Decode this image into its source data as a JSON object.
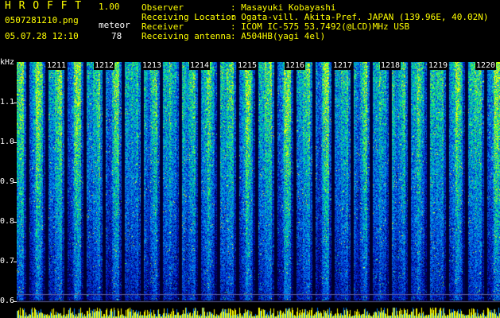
{
  "header": {
    "app_title": "H R O F F T",
    "version": "1.00",
    "filename": "0507281210.png",
    "datetime": "05.07.28 12:10",
    "meteor_label": "meteor",
    "meteor_count": "78"
  },
  "info": [
    {
      "label": "Observer",
      "value": ": Masayuki Kobayashi"
    },
    {
      "label": "Receiving Location",
      "value": ": Ogata-vill. Akita-Pref. JAPAN (139.96E, 40.02N)"
    },
    {
      "label": "Receiver",
      "value": ": ICOM IC-575 53.7492(@LCD)MHz USB"
    },
    {
      "label": "Receiving antenna",
      "value": ": A504HB(yagi 4el)"
    }
  ],
  "y_axis": {
    "unit": "kHz",
    "labels": [
      "1.1",
      "1.0",
      "0.9",
      "0.8",
      "0.7",
      "0.6"
    ]
  },
  "x_axis": {
    "minutes": [
      "1211",
      "1212",
      "1213",
      "1214",
      "1215",
      "1216",
      "1217",
      "1218",
      "1219",
      "1220"
    ]
  },
  "colors": {
    "background": "#000000",
    "text_yellow": "#ffff00",
    "text_white": "#ffffff",
    "spectrum_low": "#000080",
    "spectrum_mid": "#00a0ff",
    "spectrum_high": "#00ff80",
    "level_bar": "#ffff00"
  }
}
